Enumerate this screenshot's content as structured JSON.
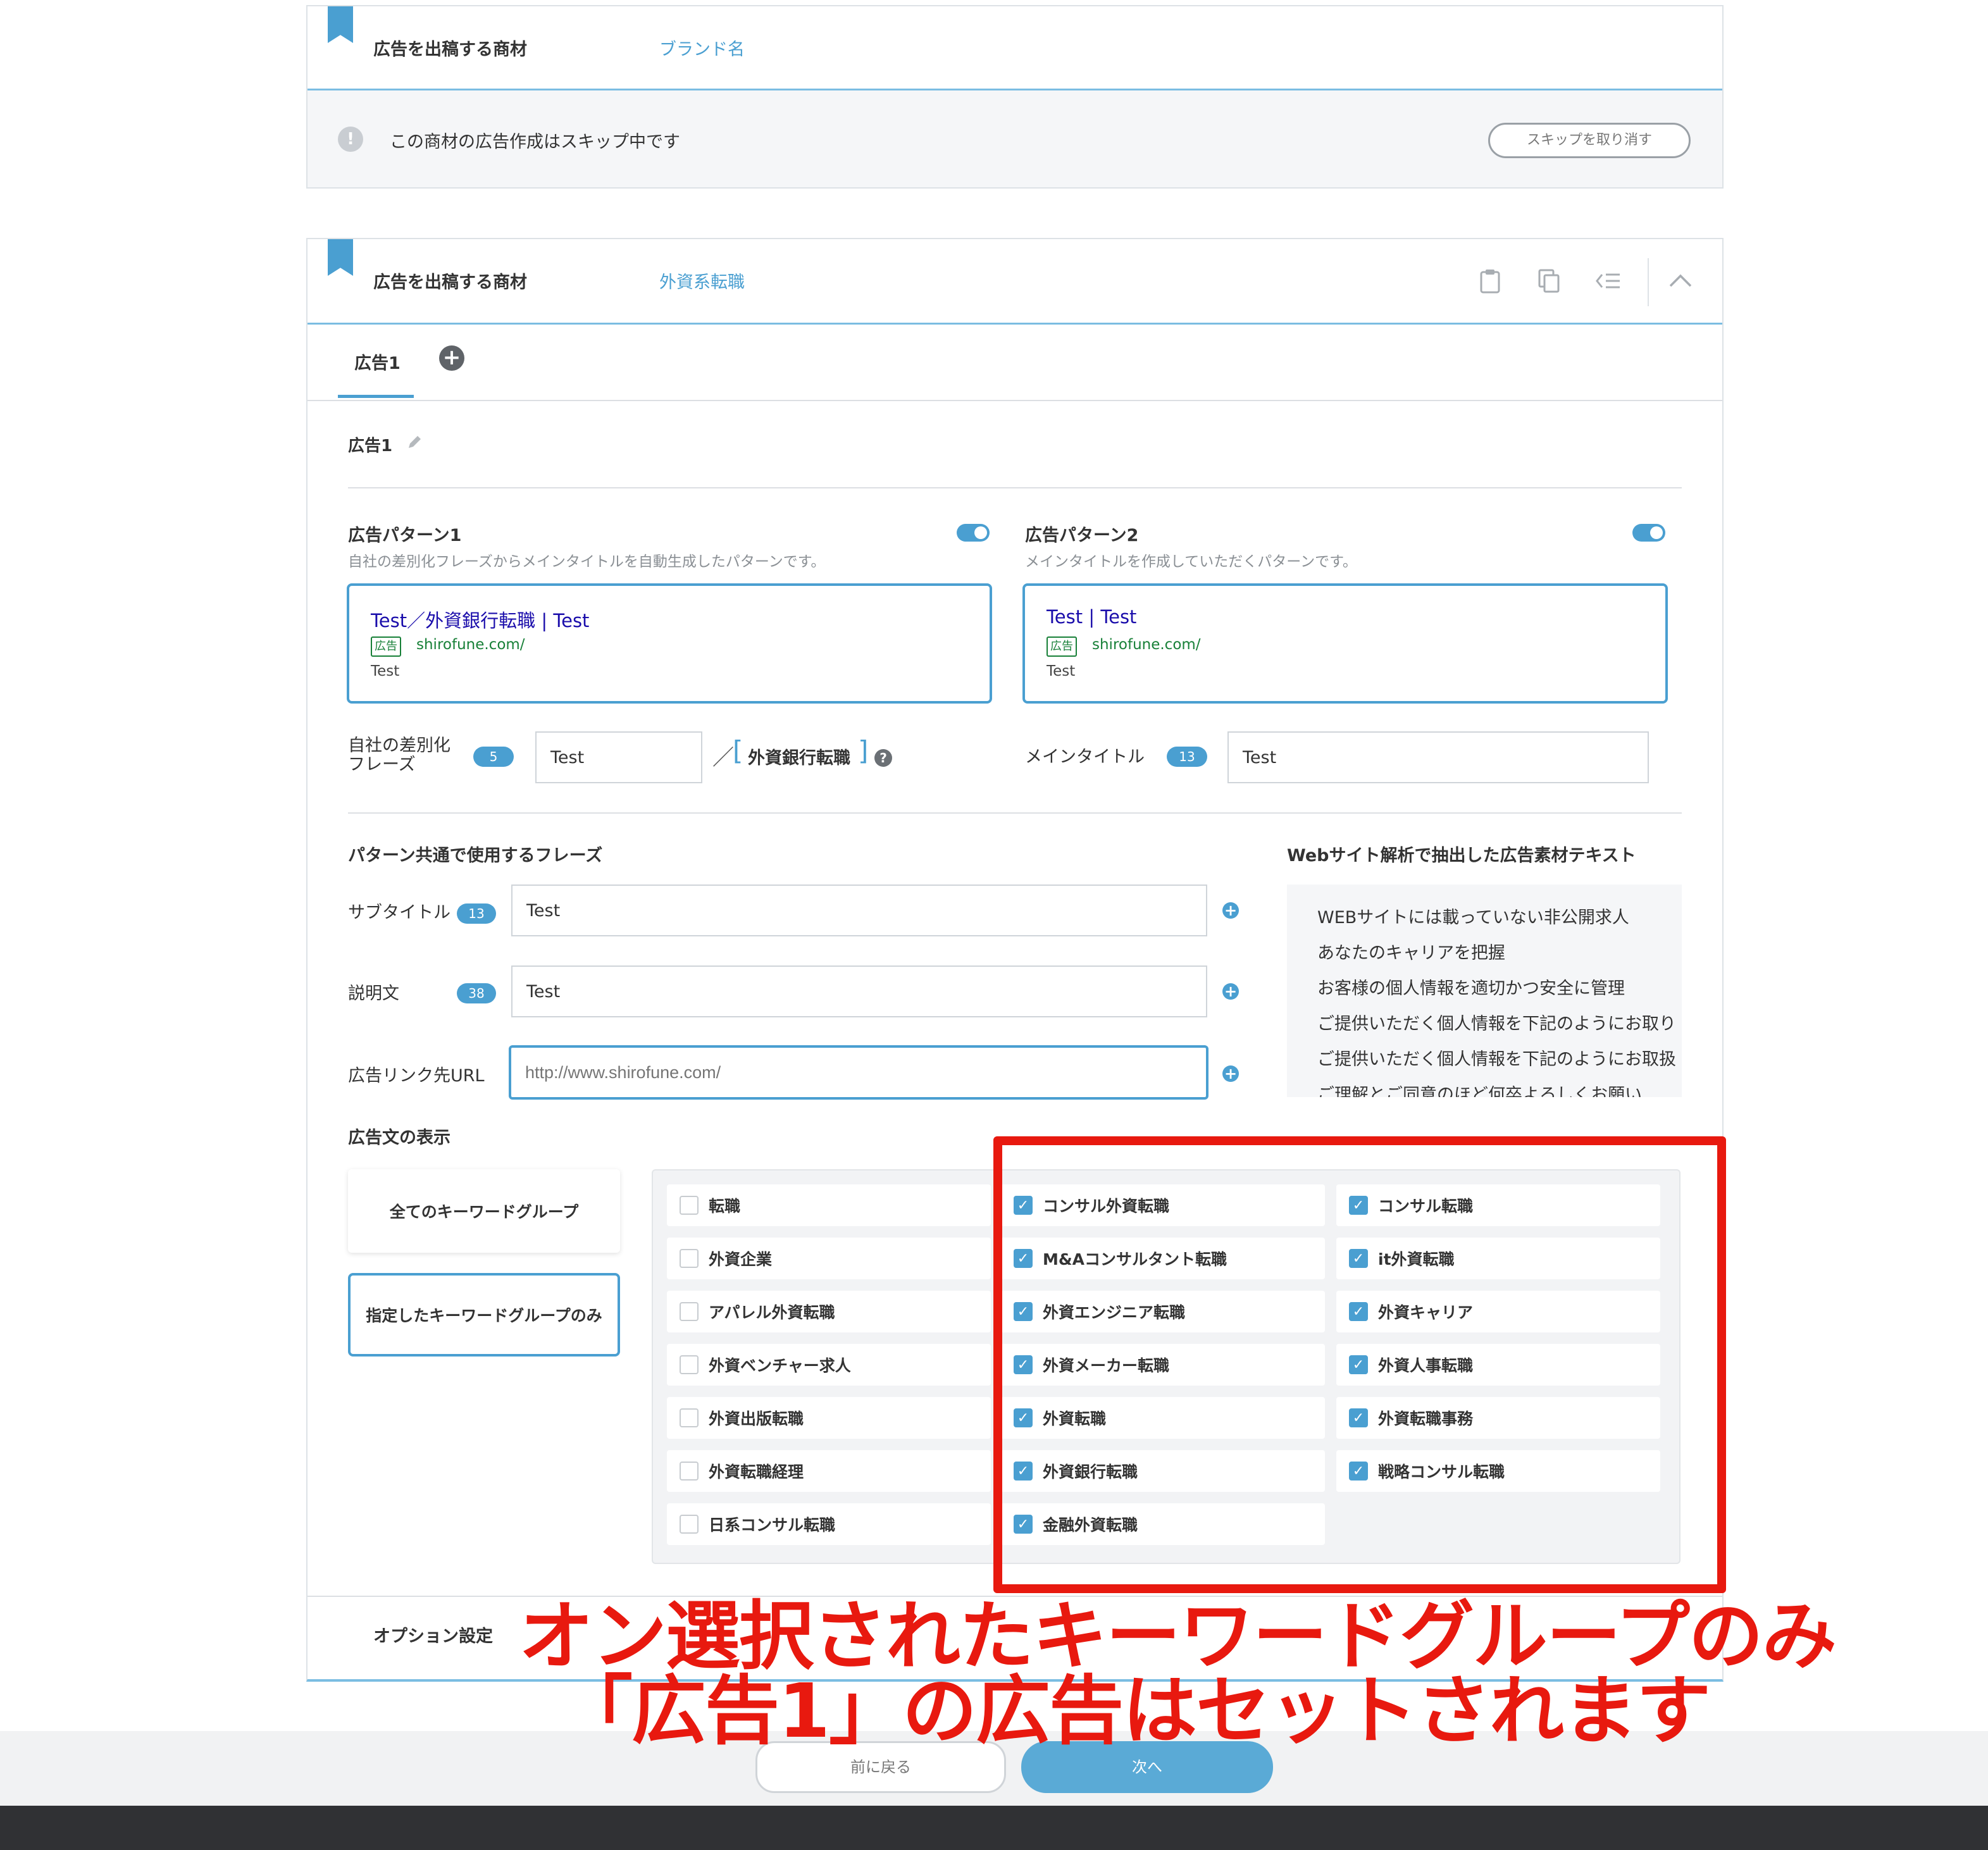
{
  "card1": {
    "label": "広告を出稿する商材",
    "value": "ブランド名",
    "skip_message": "この商材の広告作成はスキップ中です",
    "cancel_skip_button": "スキップを取り消す"
  },
  "card2": {
    "label": "広告を出稿する商材",
    "value": "外資系転職",
    "tabs": [
      "広告1"
    ],
    "ad_name": "広告1",
    "pattern1": {
      "title": "広告パターン1",
      "desc": "自社の差別化フレーズからメインタイトルを自動生成したパターンです。",
      "preview_title": "Test／外資銀行転職 | Test",
      "ad_label": "広告",
      "url": "shirofune.com/",
      "text": "Test",
      "field_label_1": "自社の差別化",
      "field_label_2": "フレーズ",
      "badge": "5",
      "input_value": "Test",
      "slash": "／",
      "bracket_open": "[",
      "bracket_text": "外資銀行転職",
      "bracket_close": "]",
      "help": "?"
    },
    "pattern2": {
      "title": "広告パターン2",
      "desc": "メインタイトルを作成していただくパターンです。",
      "preview_title": "Test | Test",
      "ad_label": "広告",
      "url": "shirofune.com/",
      "text": "Test",
      "field_label": "メインタイトル",
      "badge": "13",
      "input_value": "Test"
    },
    "common": {
      "heading": "パターン共通で使用するフレーズ",
      "subtitle_label": "サブタイトル",
      "subtitle_badge": "13",
      "subtitle_value": "Test",
      "desc_label": "説明文",
      "desc_badge": "38",
      "desc_value": "Test",
      "url_label": "広告リンク先URL",
      "url_placeholder": "http://www.shirofune.com/"
    },
    "extracted": {
      "heading": "Webサイト解析で抽出した広告素材テキスト",
      "items": [
        "WEBサイトには載っていない非公開求人",
        "あなたのキャリアを把握",
        "お客様の個人情報を適切かつ安全に管理",
        "ご提供いただく個人情報を下記のようにお取り",
        "ご提供いただく個人情報を下記のようにお取扱",
        "ご理解とご同意のほど何卒よろしくお願い"
      ]
    },
    "display": {
      "heading": "広告文の表示",
      "option_all": "全てのキーワードグループ",
      "option_specified": "指定したキーワードグループのみ"
    },
    "keywords": {
      "col1": [
        {
          "label": "転職",
          "checked": false
        },
        {
          "label": "外資企業",
          "checked": false
        },
        {
          "label": "アパレル外資転職",
          "checked": false
        },
        {
          "label": "外資ベンチャー求人",
          "checked": false
        },
        {
          "label": "外資出版転職",
          "checked": false
        },
        {
          "label": "外資転職経理",
          "checked": false
        },
        {
          "label": "日系コンサル転職",
          "checked": false
        }
      ],
      "col2": [
        {
          "label": "コンサル外資転職",
          "checked": true
        },
        {
          "label": "M&Aコンサルタント転職",
          "checked": true
        },
        {
          "label": "外資エンジニア転職",
          "checked": true
        },
        {
          "label": "外資メーカー転職",
          "checked": true
        },
        {
          "label": "外資転職",
          "checked": true
        },
        {
          "label": "外資銀行転職",
          "checked": true
        },
        {
          "label": "金融外資転職",
          "checked": true
        }
      ],
      "col3": [
        {
          "label": "コンサル転職",
          "checked": true
        },
        {
          "label": "it外資転職",
          "checked": true
        },
        {
          "label": "外資キャリア",
          "checked": true
        },
        {
          "label": "外資人事転職",
          "checked": true
        },
        {
          "label": "外資転職事務",
          "checked": true
        },
        {
          "label": "戦略コンサル転職",
          "checked": true
        }
      ]
    },
    "options_label": "オプション設定"
  },
  "annotation": {
    "line1": "オン選択されたキーワードグループのみ",
    "line2": "「広告1」の広告はセットされます",
    "color": "#e8190f"
  },
  "footer": {
    "back_button": "前に戻る",
    "next_button": "次へ"
  },
  "colors": {
    "accent": "#4a9fd1",
    "annotation_red": "#e8190f",
    "bottom_bar": "#303134"
  },
  "icons": [
    "bookmark-icon",
    "info-icon",
    "clipboard-icon",
    "copy-icon",
    "list-icon",
    "chevron-up-icon",
    "add-tab-icon",
    "pencil-icon",
    "help-icon",
    "add-icon",
    "checkmark-icon"
  ]
}
